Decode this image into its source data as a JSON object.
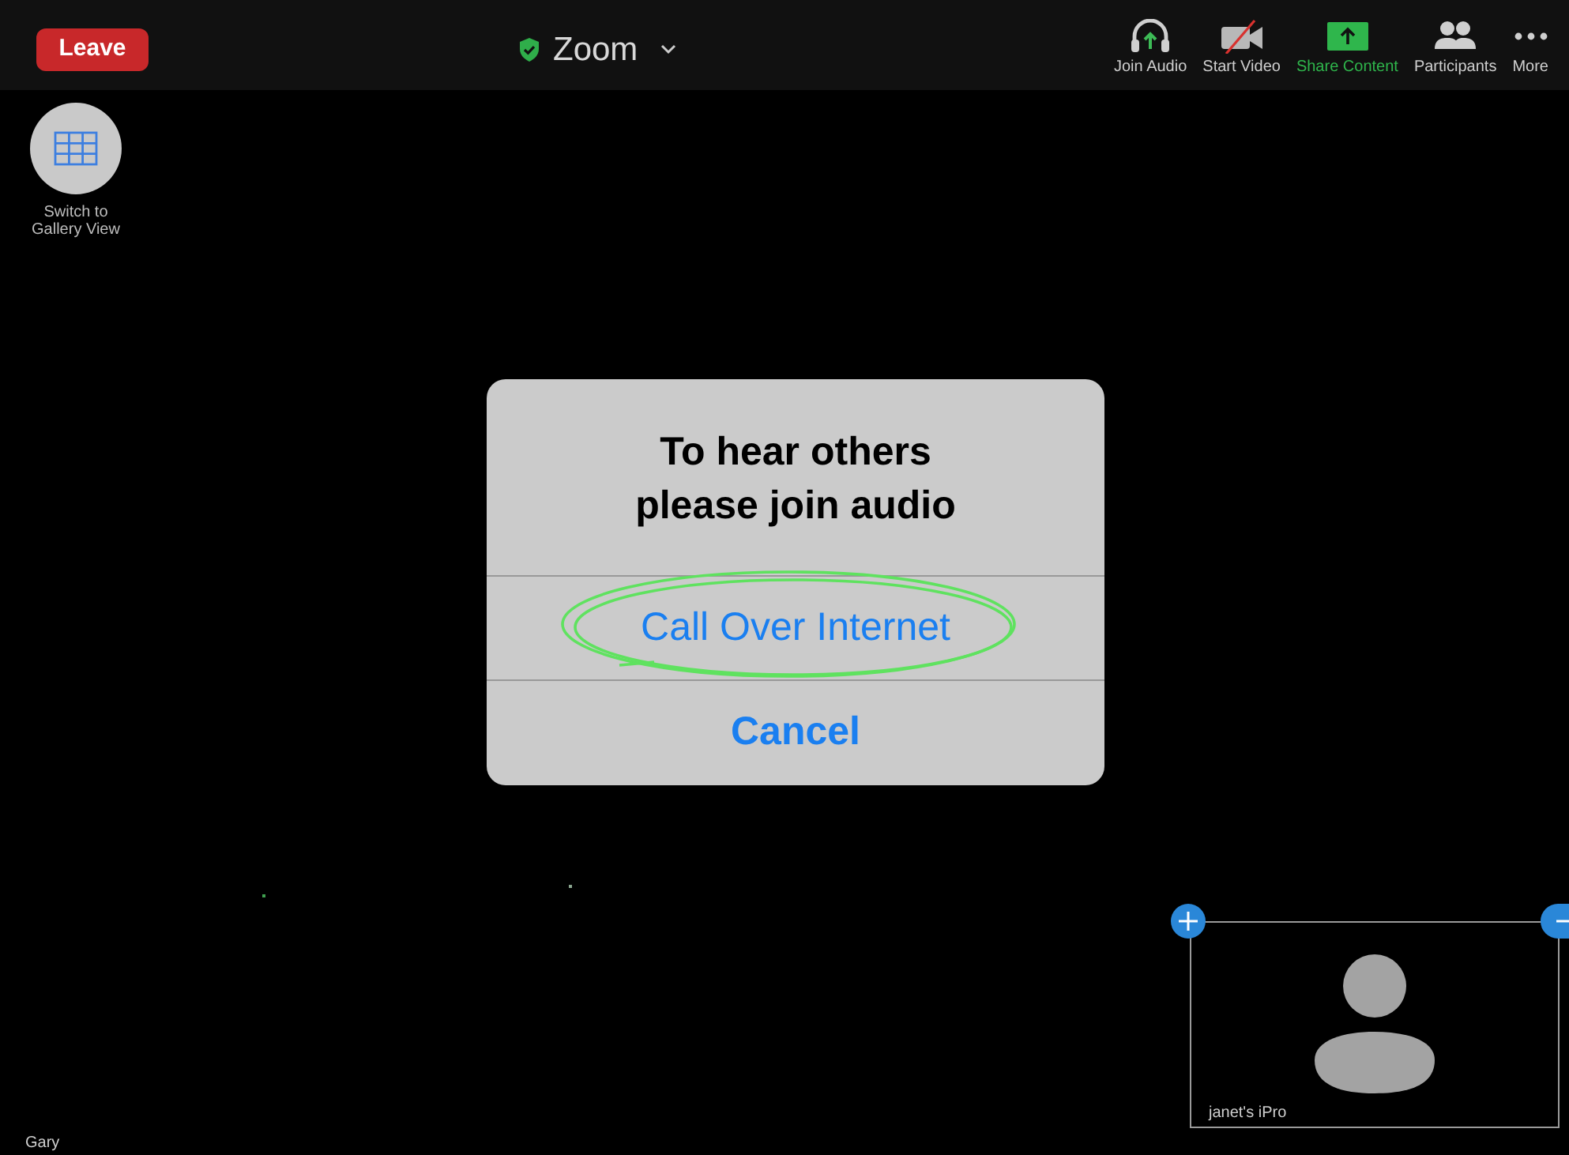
{
  "top_bar": {
    "leave_button": "Leave",
    "meeting_title": "Zoom",
    "toolbar": [
      {
        "kind": "audio",
        "label": "Join Audio",
        "active": false
      },
      {
        "kind": "video",
        "label": "Start Video",
        "active": false
      },
      {
        "kind": "share",
        "label": "Share Content",
        "active": true
      },
      {
        "kind": "participants",
        "label": "Participants",
        "active": false
      },
      {
        "kind": "more",
        "label": "More",
        "active": false
      }
    ]
  },
  "gallery_button": {
    "label": "Switch to Gallery View"
  },
  "dialog": {
    "title": "To hear others please join audio",
    "buttons": [
      {
        "label": "Call Over Internet",
        "circled": true,
        "bold": false
      },
      {
        "label": "Cancel",
        "circled": false,
        "bold": true
      }
    ]
  },
  "main_video": {
    "name": "Gary"
  },
  "thumbnail": {
    "name": "janet's iPro"
  }
}
